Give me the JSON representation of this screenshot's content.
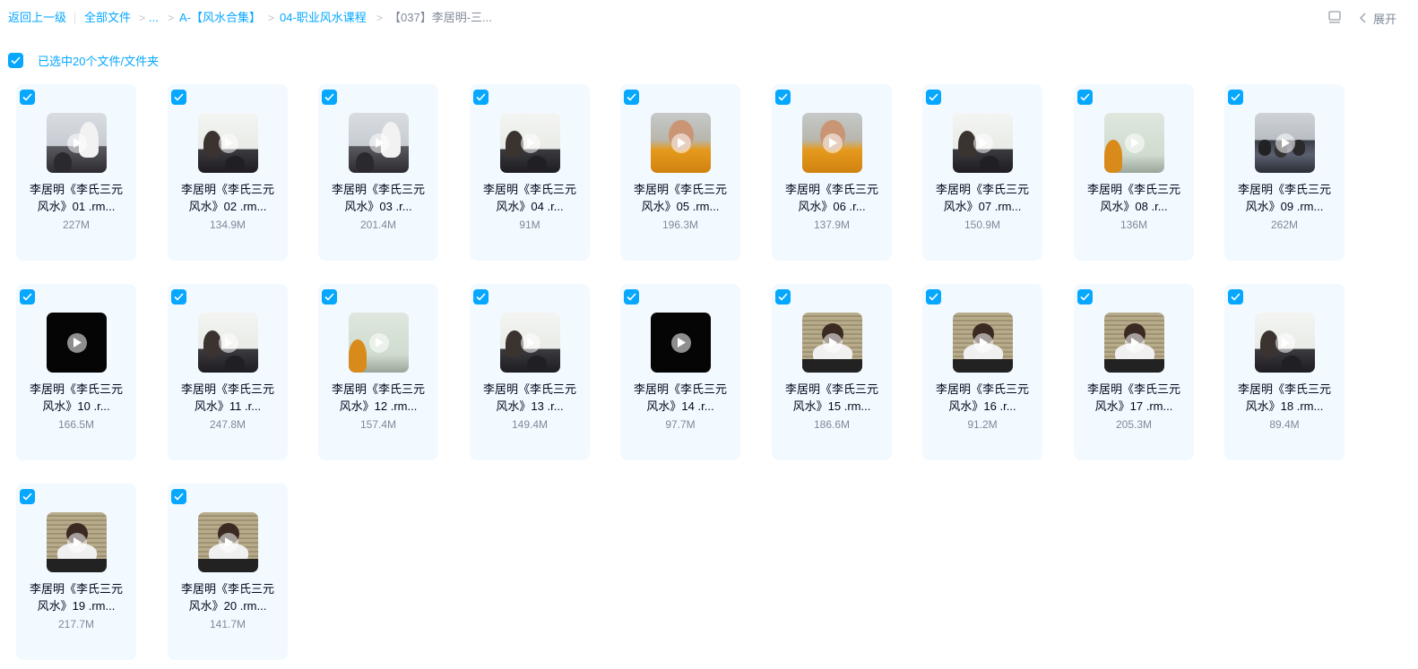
{
  "breadcrumb": {
    "back": "返回上一级",
    "all_files": "全部文件",
    "ellipsis": "...",
    "level1": "A-【风水合集】",
    "level2": "04-职业风水课程",
    "current": "【037】李居明-三...",
    "separator": ">"
  },
  "toolbar": {
    "list_icon": "list-view-icon",
    "expand_label": "展开",
    "expand_icon": "chevron-left-icon"
  },
  "selection": {
    "label": "已选中20个文件/文件夹",
    "accent": "#06a7ff"
  },
  "files": [
    {
      "line1": "李居明《李氏三元",
      "line2": "风水》01 .rm...",
      "size": "227M",
      "thumb": "room"
    },
    {
      "line1": "李居明《李氏三元",
      "line2": "风水》02 .rm...",
      "size": "134.9M",
      "thumb": "board"
    },
    {
      "line1": "李居明《李氏三元",
      "line2": "风水》03 .r...",
      "size": "201.4M",
      "thumb": "room"
    },
    {
      "line1": "李居明《李氏三元",
      "line2": "风水》04 .r...",
      "size": "91M",
      "thumb": "board"
    },
    {
      "line1": "李居明《李氏三元",
      "line2": "风水》05 .rm...",
      "size": "196.3M",
      "thumb": "orange"
    },
    {
      "line1": "李居明《李氏三元",
      "line2": "风水》06 .r...",
      "size": "137.9M",
      "thumb": "orange"
    },
    {
      "line1": "李居明《李氏三元",
      "line2": "风水》07 .rm...",
      "size": "150.9M",
      "thumb": "board"
    },
    {
      "line1": "李居明《李氏三元",
      "line2": "风水》08 .r...",
      "size": "136M",
      "thumb": "green"
    },
    {
      "line1": "李居明《李氏三元",
      "line2": "风水》09 .rm...",
      "size": "262M",
      "thumb": "crowd"
    },
    {
      "line1": "李居明《李氏三元",
      "line2": "风水》10 .r...",
      "size": "166.5M",
      "thumb": "black"
    },
    {
      "line1": "李居明《李氏三元",
      "line2": "风水》11 .r...",
      "size": "247.8M",
      "thumb": "board"
    },
    {
      "line1": "李居明《李氏三元",
      "line2": "风水》12 .rm...",
      "size": "157.4M",
      "thumb": "green"
    },
    {
      "line1": "李居明《李氏三元",
      "line2": "风水》13 .r...",
      "size": "149.4M",
      "thumb": "board"
    },
    {
      "line1": "李居明《李氏三元",
      "line2": "风水》14 .r...",
      "size": "97.7M",
      "thumb": "black"
    },
    {
      "line1": "李居明《李氏三元",
      "line2": "风水》15 .rm...",
      "size": "186.6M",
      "thumb": "blinds"
    },
    {
      "line1": "李居明《李氏三元",
      "line2": "风水》16 .r...",
      "size": "91.2M",
      "thumb": "blinds"
    },
    {
      "line1": "李居明《李氏三元",
      "line2": "风水》17 .rm...",
      "size": "205.3M",
      "thumb": "blinds"
    },
    {
      "line1": "李居明《李氏三元",
      "line2": "风水》18 .rm...",
      "size": "89.4M",
      "thumb": "board"
    },
    {
      "line1": "李居明《李氏三元",
      "line2": "风水》19 .rm...",
      "size": "217.7M",
      "thumb": "blinds"
    },
    {
      "line1": "李居明《李氏三元",
      "line2": "风水》20 .rm...",
      "size": "141.7M",
      "thumb": "blinds"
    }
  ]
}
